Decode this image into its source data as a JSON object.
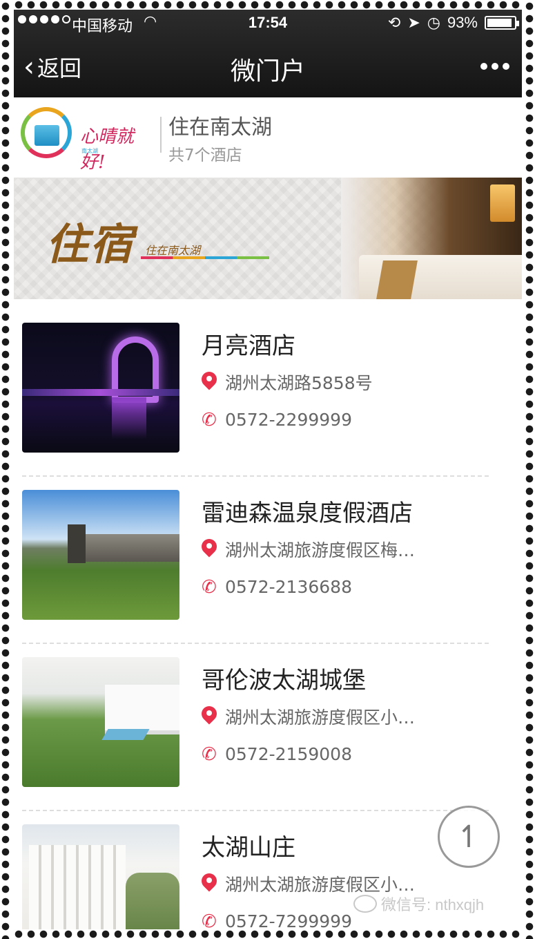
{
  "status_bar": {
    "carrier": "中国移动",
    "time": "17:54",
    "battery": "93%",
    "battery_level": 0.93
  },
  "nav": {
    "back_label": "返回",
    "title": "微门户",
    "more_icon": "ellipsis-icon"
  },
  "brand": {
    "logo_text": "心晴就好!",
    "logo_small": "南太湖",
    "name": "住在南太湖",
    "count": "共7个酒店"
  },
  "banner": {
    "word": "住宿",
    "tag": "住在南太湖"
  },
  "hotels": [
    {
      "name": "月亮酒店",
      "address": "湖州太湖路5858号",
      "phone": "0572-2299999"
    },
    {
      "name": "雷迪森温泉度假酒店",
      "address": "湖州太湖旅游度假区梅…",
      "phone": "0572-2136688"
    },
    {
      "name": "哥伦波太湖城堡",
      "address": "湖州太湖旅游度假区小…",
      "phone": "0572-2159008"
    },
    {
      "name": "太湖山庄",
      "address": "湖州太湖旅游度假区小…",
      "phone": "0572-7299999"
    }
  ],
  "watermark": "微信号: nthxqjh",
  "colors": {
    "accent_red": "#e8304a",
    "nav_bg": "#1a1a1a"
  }
}
